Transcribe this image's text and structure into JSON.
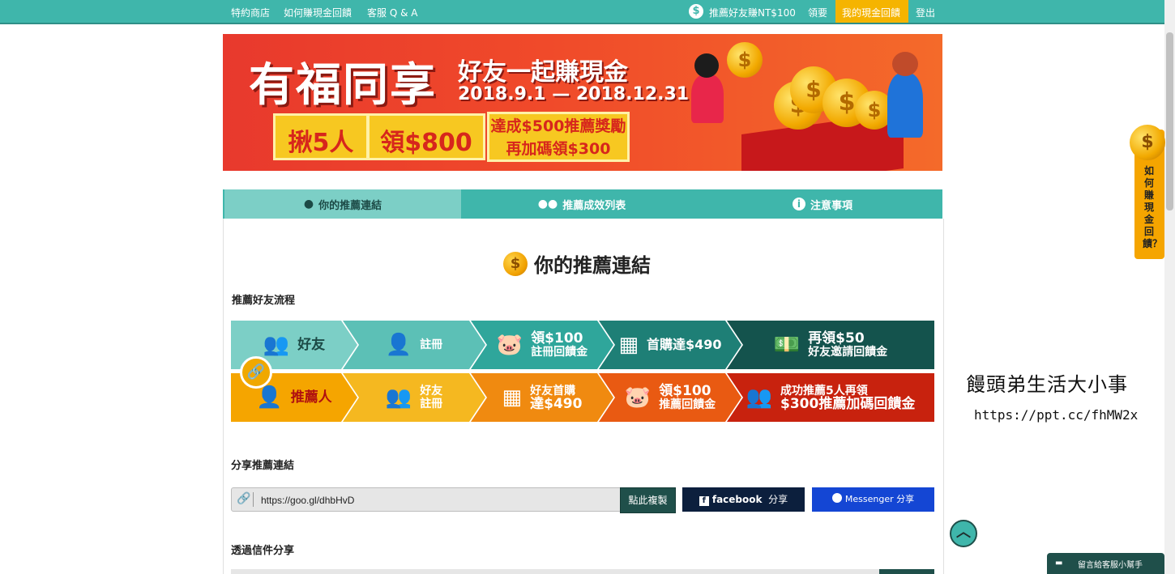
{
  "topnav": {
    "links": [
      "特約商店",
      "如何賺現金回饋",
      "客服 Q & A"
    ],
    "refer_coin": "$",
    "refer_label": "推薦好友賺NT$100",
    "claim": "領要",
    "my_cash": "我的現金回饋",
    "logout": "登出"
  },
  "banner": {
    "title": "有福同享",
    "subtitle": "好友一起賺現金",
    "dates": "2018.9.1 — 2018.12.31",
    "badge1": "揪5人",
    "badge2": "領$800",
    "badge3_line1": "達成$500推薦獎勵",
    "badge3_line2": "再加碼領$300"
  },
  "tabs": [
    {
      "label": "你的推薦連結",
      "icon": "user-icon"
    },
    {
      "label": "推薦成效列表",
      "icon": "users-icon"
    },
    {
      "label": "注意事項",
      "icon": "info-icon"
    }
  ],
  "section": {
    "title": "你的推薦連結",
    "coin": "$",
    "flow_heading": "推薦好友流程",
    "share_heading": "分享推薦連結",
    "mail_heading": "透過信件分享"
  },
  "flow_friend": [
    {
      "icon": "users-icon",
      "glyph": "👥",
      "text": "好友"
    },
    {
      "icon": "user-add-icon",
      "glyph": "👤",
      "text": "註冊"
    },
    {
      "icon": "piggy-bank-icon",
      "glyph": "🐷",
      "line1": "領$100",
      "line2": "註冊回饋金"
    },
    {
      "icon": "card-reader-icon",
      "glyph": "▦",
      "text": "首購達$490"
    },
    {
      "icon": "cash-icon",
      "glyph": "💵",
      "line1": "再領$50",
      "line2": "好友邀請回饋金"
    }
  ],
  "flow_referrer": [
    {
      "icon": "user-icon",
      "glyph": "👤",
      "text": "推薦人"
    },
    {
      "icon": "user-add-icon",
      "glyph": "👥",
      "line1": "好友",
      "line2": "註冊"
    },
    {
      "icon": "card-reader-icon",
      "glyph": "▦",
      "line1": "好友首購",
      "line2": "達$490"
    },
    {
      "icon": "piggy-bank-icon",
      "glyph": "🐷",
      "line1": "領$100",
      "line2": "推薦回饋金"
    },
    {
      "icon": "users-check-icon",
      "glyph": "👥",
      "line1": "成功推薦5人再領",
      "line2": "$300推薦加碼回饋金"
    }
  ],
  "share": {
    "url": "https://goo.gl/dhbHvD",
    "copy_label": "點此複製",
    "facebook_label": "facebook",
    "facebook_share": "分享",
    "messenger_label": "Messenger",
    "messenger_share": "分享"
  },
  "side_widget": {
    "coin": "$",
    "text": "如何賺現金回饋？"
  },
  "watermark": {
    "line1": "饅頭弟生活大小事",
    "line2": "https://ppt.cc/fhMW2x"
  },
  "help_box": {
    "icon": "▬",
    "label": "留言給客服小幫手"
  },
  "colors": {
    "teal": "#3fb6ab",
    "orange": "#f5a500",
    "dark_teal": "#1f4f4a"
  }
}
